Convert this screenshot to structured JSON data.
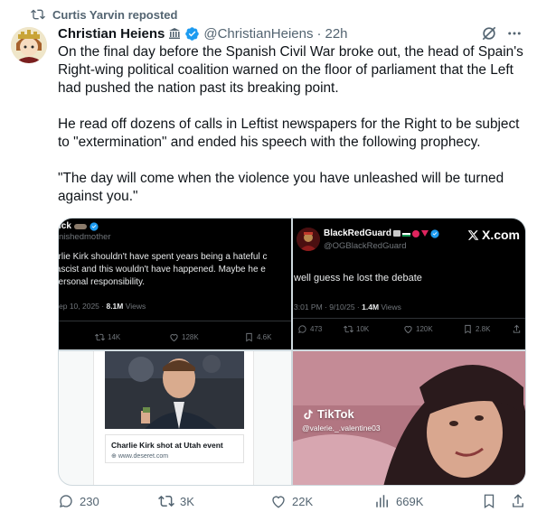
{
  "repost": {
    "label": "Curtis Yarvin reposted"
  },
  "author": {
    "name": "Christian Heiens",
    "handle": "@ChristianHeiens",
    "time": "22h",
    "verified_color": "#1d9bf0"
  },
  "tweet": {
    "paragraphs": [
      "On the final day before the Spanish Civil War broke out, the head of Spain's Right-wing political coalition warned on the floor of parliament that the Left had pushed the nation past its breaking point.",
      "He read off dozens of calls in Leftist newspapers for the Right to be subject to \"extermination\" and ended his speech with the following prophecy.",
      "\"The day will come when the violence you have unleashed will be turned against you.\""
    ]
  },
  "media": {
    "img1": {
      "name": "ick",
      "handle": "nishedmother",
      "body": "arlie Kirk shouldn't have spent years being a hateful c fascist and this wouldn't have happened. Maybe he e personal responsibility.",
      "date": "ep 10, 2025 · ",
      "views_count": "8.1M",
      "views_label": " Views",
      "retweets": "14K",
      "likes": "128K",
      "bookmarks": "4.6K"
    },
    "img2": {
      "name": "BlackRedGuard",
      "handle": "@OGBlackRedGuard",
      "brand": "X.com",
      "body": "well guess he lost the debate",
      "date": "3:01 PM · 9/10/25 · ",
      "views_count": "1.4M",
      "views_label": " Views",
      "replies": "473",
      "retweets": "10K",
      "likes": "120K",
      "bookmarks": "2.8K"
    },
    "img3": {
      "headline": "Charlie Kirk shot at Utah event",
      "source": "www.deseret.com"
    },
    "img4": {
      "brand": "TikTok",
      "handle": "@valerie._.valentine03"
    }
  },
  "footer": {
    "replies": "230",
    "reposts": "3K",
    "likes": "22K",
    "views": "669K"
  },
  "colors": {
    "text": "#0f1419",
    "muted": "#536471",
    "accent": "#1d9bf0"
  }
}
